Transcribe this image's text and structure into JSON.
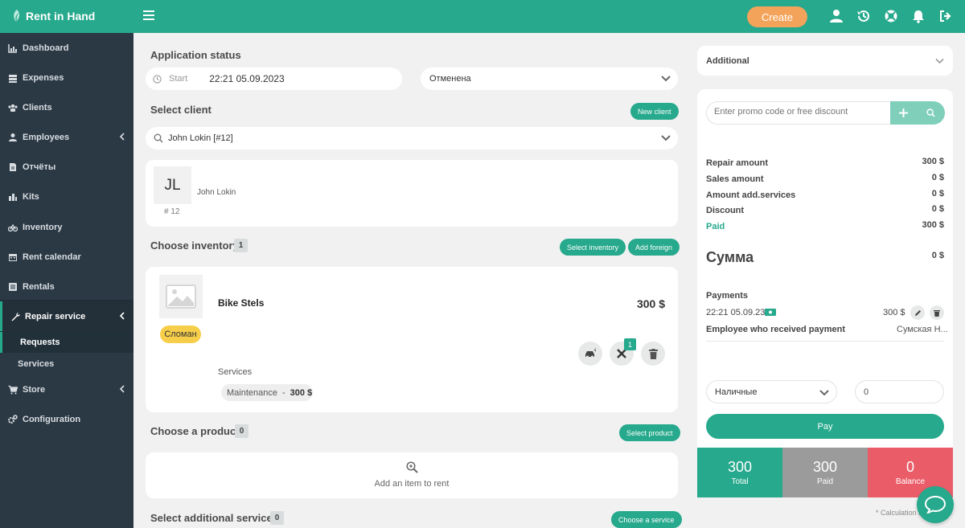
{
  "brand": {
    "name": "Rent in Hand"
  },
  "topbar": {
    "create_label": "Create",
    "icons": [
      "hamburger-icon",
      "user-icon",
      "history-icon",
      "lifebuoy-icon",
      "bell-icon",
      "logout-icon"
    ]
  },
  "sidebar": {
    "items": [
      {
        "label": "Dashboard",
        "icon": "chart-icon"
      },
      {
        "label": "Expenses",
        "icon": "money-icon"
      },
      {
        "label": "Clients",
        "icon": "users-icon"
      },
      {
        "label": "Employees",
        "icon": "user-icon"
      },
      {
        "label": "Отчёты",
        "icon": "file-icon"
      },
      {
        "label": "Kits",
        "icon": "grid-icon"
      },
      {
        "label": "Inventory",
        "icon": "bike-icon"
      },
      {
        "label": "Rent calendar",
        "icon": "calendar-icon"
      },
      {
        "label": "Rentals",
        "icon": "list-icon"
      },
      {
        "label": "Repair service",
        "icon": "wrench-icon"
      },
      {
        "label": "Store",
        "icon": "cart-icon"
      },
      {
        "label": "Configuration",
        "icon": "cogs-icon"
      }
    ],
    "repair_sub": [
      "Requests",
      "Services"
    ]
  },
  "app_status": {
    "title": "Application status",
    "start_label": "Start",
    "start_value": "22:21 05.09.2023",
    "status_value": "Отменена"
  },
  "client": {
    "title": "Select client",
    "new_client_label": "New client",
    "search_value": "John Lokin [#12]",
    "initials": "JL",
    "name": "John Lokin",
    "id_text": "# 12"
  },
  "inventory": {
    "title": "Choose inventory",
    "count": "1",
    "select_label": "Select inventory",
    "add_foreign_label": "Add foreign",
    "item_name": "Bike Stels",
    "item_price": "300 $",
    "status_badge": "Сломан",
    "services_label": "Services",
    "service_name": "Maintenance",
    "service_sep": "-",
    "service_price": "300 $",
    "repair_count": "1"
  },
  "product": {
    "title": "Choose a product",
    "count": "0",
    "select_label": "Select product",
    "empty_text": "Add an item to rent"
  },
  "additional_services": {
    "title": "Select additional services",
    "count": "0",
    "choose_label": "Choose a service"
  },
  "right": {
    "additional_title": "Additional",
    "promo_placeholder": "Enter promo code or free discount",
    "rows": [
      {
        "label": "Repair amount",
        "value": "300 $"
      },
      {
        "label": "Sales amount",
        "value": "0 $"
      },
      {
        "label": "Amount add.services",
        "value": "0 $"
      },
      {
        "label": "Discount",
        "value": "0 $"
      },
      {
        "label": "Paid",
        "value": "300 $"
      }
    ],
    "sum_label": "Сумма",
    "sum_value": "0 $",
    "payments_title": "Payments",
    "payment_date": "22:21 05.09.23",
    "payment_amount": "300 $",
    "employee_label": "Employee who received payment",
    "employee_value": "Сумская Н...",
    "method_value": "Наличные",
    "amount_input": "0",
    "pay_label": "Pay",
    "totals": [
      {
        "value": "300",
        "label": "Total"
      },
      {
        "value": "300",
        "label": "Paid"
      },
      {
        "value": "0",
        "label": "Balance"
      }
    ],
    "footnote": "* Calculation i"
  },
  "colors": {
    "accent": "#26a98c",
    "sidebar": "#2b3945",
    "create": "#f4a35a",
    "balance": "#ea5d68",
    "paid_gray": "#9b9b9b",
    "badge_yellow": "#f7ce4a"
  }
}
